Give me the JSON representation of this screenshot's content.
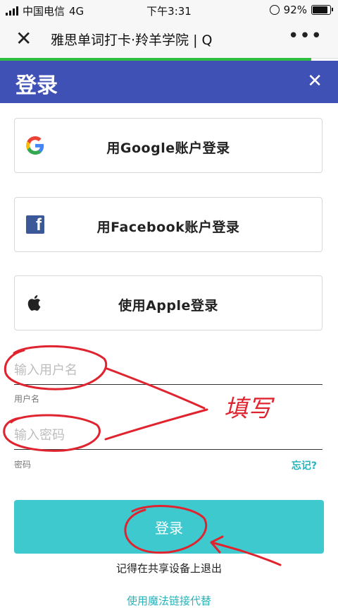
{
  "status_bar": {
    "carrier": "中国电信",
    "network": "4G",
    "time": "下午3:31",
    "battery": "92%",
    "battery_level": 0.92
  },
  "nav": {
    "title": "雅思单词打卡·羚羊学院 | Q"
  },
  "dialog": {
    "title": "登录"
  },
  "providers": {
    "google": "用Google账户登录",
    "facebook": "用Facebook账户登录",
    "apple": "使用Apple登录"
  },
  "form": {
    "username_placeholder": "输入用户名",
    "username_caption": "用户名",
    "password_placeholder": "输入密码",
    "password_caption": "密码",
    "forgot": "忘记?",
    "submit": "登录",
    "remember": "记得在共享设备上退出",
    "magic_link": "使用魔法链接代替"
  },
  "annotation": {
    "handwriting": "填写"
  },
  "colors": {
    "header": "#3f51b5",
    "accent": "#3ec9cf",
    "link": "#26b3b9",
    "annotation": "#e0242f"
  }
}
